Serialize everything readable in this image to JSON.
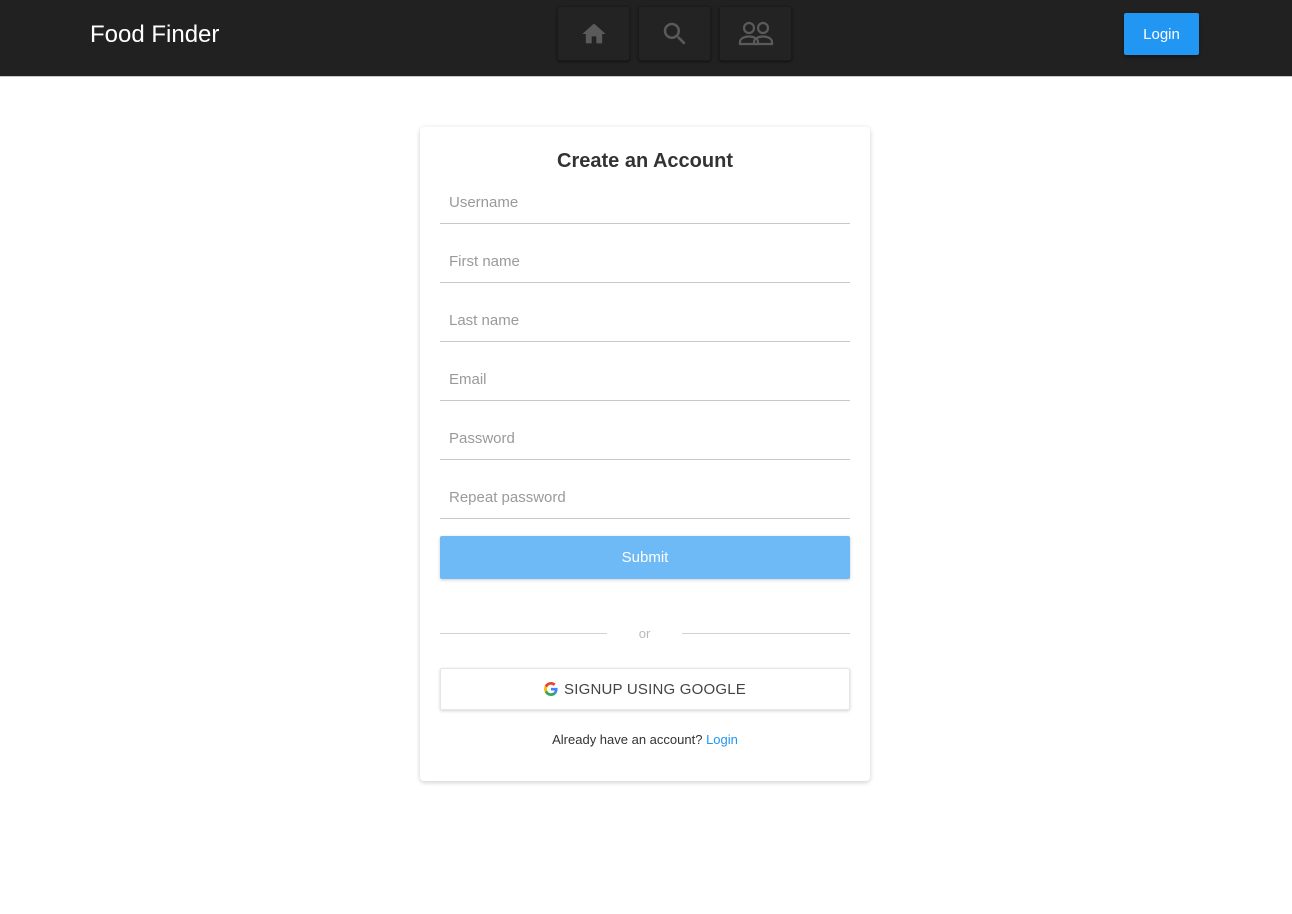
{
  "navbar": {
    "brand": "Food Finder",
    "icons": [
      "home-icon",
      "search-icon",
      "people-icon"
    ],
    "login_label": "Login",
    "colors": {
      "background": "#212121",
      "accent": "#2196f3"
    }
  },
  "form": {
    "title": "Create an Account",
    "fields": [
      {
        "placeholder": "Username",
        "value": ""
      },
      {
        "placeholder": "First name",
        "value": ""
      },
      {
        "placeholder": "Last name",
        "value": ""
      },
      {
        "placeholder": "Email",
        "value": ""
      },
      {
        "placeholder": "Password",
        "value": ""
      },
      {
        "placeholder": "Repeat password",
        "value": ""
      }
    ],
    "submit_label": "Submit",
    "divider_text": "or",
    "google_label": "SIGNUP USING GOOGLE",
    "google_icon": "google-icon",
    "footer_text": "Already have an account?",
    "footer_link": "Login",
    "colors": {
      "submit": "#6ebaf7",
      "link": "#2196f3"
    }
  }
}
